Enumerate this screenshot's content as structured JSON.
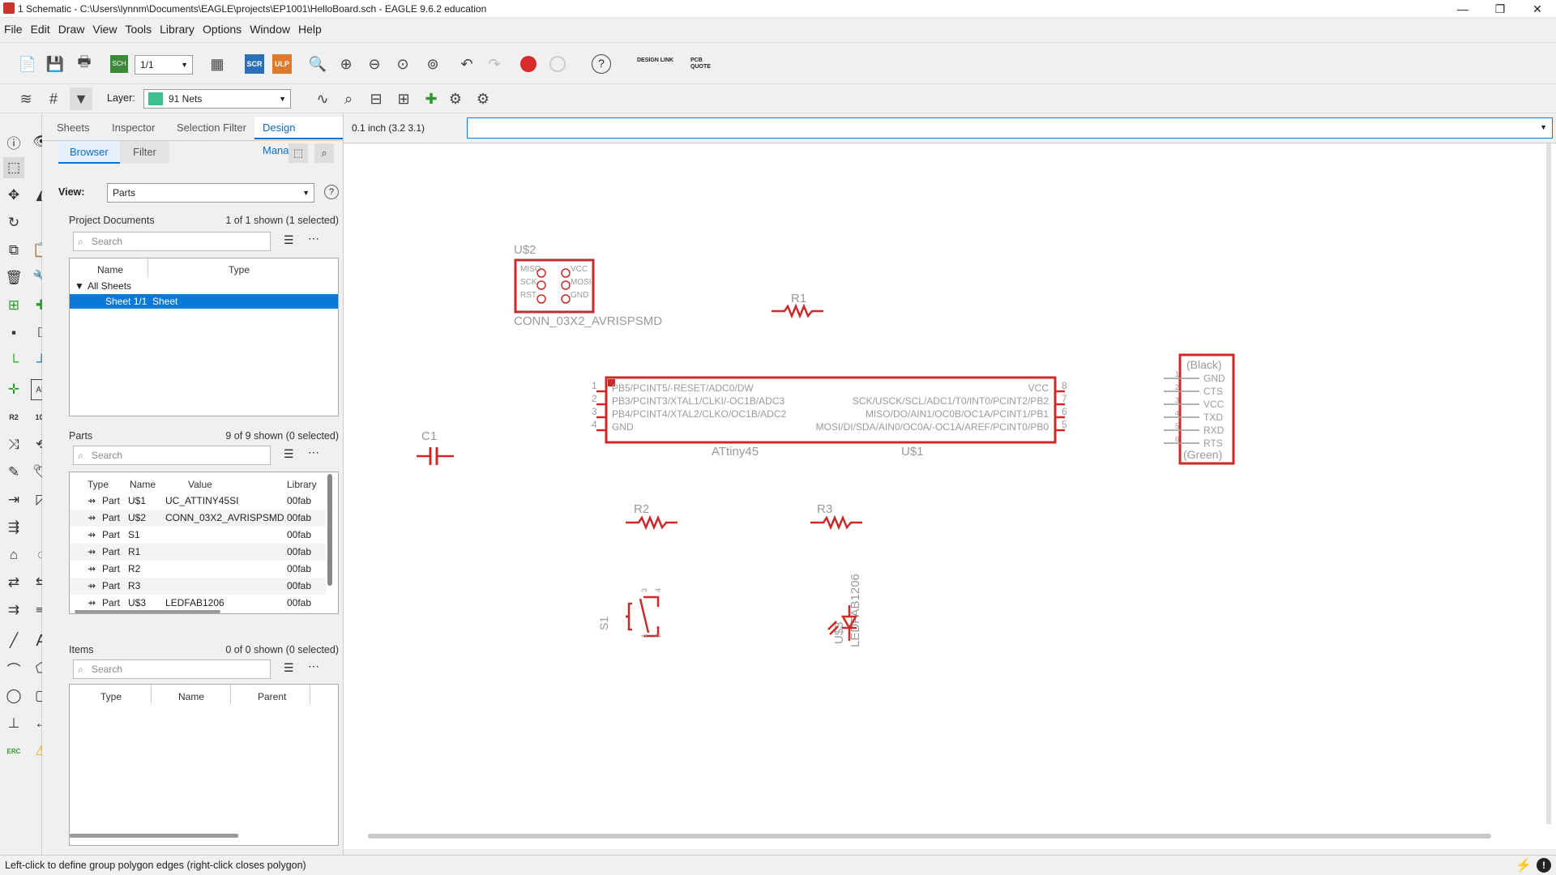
{
  "window": {
    "title": "1 Schematic - C:\\Users\\lynnm\\Documents\\EAGLE\\projects\\EP1001\\HelloBoard.sch - EAGLE 9.6.2 education",
    "minimize": "—",
    "restore": "❐",
    "close": "✕"
  },
  "menu": [
    "File",
    "Edit",
    "Draw",
    "View",
    "Tools",
    "Library",
    "Options",
    "Window",
    "Help"
  ],
  "toolbar": {
    "sheet_select": "1/1",
    "scr": "SCR",
    "ulp": "ULP",
    "design_link": "DESIGN LINK",
    "pcb_quote": "PCB QUOTE",
    "help": "?"
  },
  "layerbar": {
    "label": "Layer:",
    "layer_value": "91 Nets",
    "layer_color": "#3fbf8f"
  },
  "panel": {
    "tabs": [
      "Sheets",
      "Inspector",
      "Selection Filter",
      "Design Manager"
    ],
    "subtabs": [
      "Browser",
      "Filter"
    ],
    "view_label": "View:",
    "view_value": "Parts",
    "project_docs": {
      "title": "Project Documents",
      "count": "1 of 1 shown (1 selected)",
      "search": "Search",
      "columns": [
        "Name",
        "Type"
      ],
      "group": "All Sheets",
      "rows": [
        {
          "name": "Sheet 1/1",
          "type": "Sheet"
        }
      ]
    },
    "parts": {
      "title": "Parts",
      "count": "9 of 9 shown (0 selected)",
      "search": "Search",
      "columns": [
        "Type",
        "Name",
        "Value",
        "Library"
      ],
      "rows": [
        {
          "type": "Part",
          "name": "U$1",
          "value": "UC_ATTINY45SI",
          "library": "00fab"
        },
        {
          "type": "Part",
          "name": "U$2",
          "value": "CONN_03X2_AVRISPSMD",
          "library": "00fab"
        },
        {
          "type": "Part",
          "name": "S1",
          "value": "",
          "library": "00fab"
        },
        {
          "type": "Part",
          "name": "R1",
          "value": "",
          "library": "00fab"
        },
        {
          "type": "Part",
          "name": "R2",
          "value": "",
          "library": "00fab"
        },
        {
          "type": "Part",
          "name": "R3",
          "value": "",
          "library": "00fab"
        },
        {
          "type": "Part",
          "name": "U$3",
          "value": "LEDFAB1206",
          "library": "00fab"
        }
      ]
    },
    "items": {
      "title": "Items",
      "count": "0 of 0 shown (0 selected)",
      "search": "Search",
      "columns": [
        "Type",
        "Name",
        "Parent"
      ]
    }
  },
  "coord": "0.1 inch (3.2 3.1)",
  "command_input": "",
  "schematic": {
    "u2": {
      "name": "U$2",
      "value": "CONN_03X2_AVRISPSMD",
      "left_pins": [
        "MISO",
        "SCK",
        "RST"
      ],
      "right_pins": [
        "VCC",
        "MOSI",
        "GND"
      ]
    },
    "r1": "R1",
    "r2": "R2",
    "r3": "R3",
    "c1": "C1",
    "u1": {
      "name": "U$1",
      "value": "ATtiny45",
      "left_pins": [
        {
          "num": "1",
          "label": "PB5/PCINT5/-RESET/ADC0/DW"
        },
        {
          "num": "2",
          "label": "PB3/PCINT3/XTAL1/CLKI/-OC1B/ADC3"
        },
        {
          "num": "3",
          "label": "PB4/PCINT4/XTAL2/CLKO/OC1B/ADC2"
        },
        {
          "num": "4",
          "label": "GND"
        }
      ],
      "right_pins": [
        {
          "num": "8",
          "label": "VCC"
        },
        {
          "num": "7",
          "label": "SCK/USCK/SCL/ADC1/T0/INT0/PCINT2/PB2"
        },
        {
          "num": "6",
          "label": "MISO/DO/AIN1/OC0B/OC1A/PCINT1/PB1"
        },
        {
          "num": "5",
          "label": "MOSI/DI/SDA/AIN0/OC0A/-OC1A/AREF/PCINT0/PB0"
        }
      ]
    },
    "ftdi": {
      "top": "(Black)",
      "bottom": "(Green)",
      "pins": [
        "GND",
        "CTS",
        "VCC",
        "TXD",
        "RXD",
        "RTS"
      ],
      "nums": [
        "1",
        "2",
        "3",
        "4",
        "5",
        "6"
      ]
    },
    "s1": "S1",
    "s1_pins": [
      "3",
      "4",
      "1",
      "2"
    ],
    "u3": {
      "name": "U$3",
      "value": "LEDFAB1206"
    }
  },
  "status": "Left-click to define group polygon edges (right-click closes polygon)",
  "colors": {
    "accent": "#0a6ecb",
    "part": "#cc2a2a",
    "selected_row": "#0a78d7"
  }
}
